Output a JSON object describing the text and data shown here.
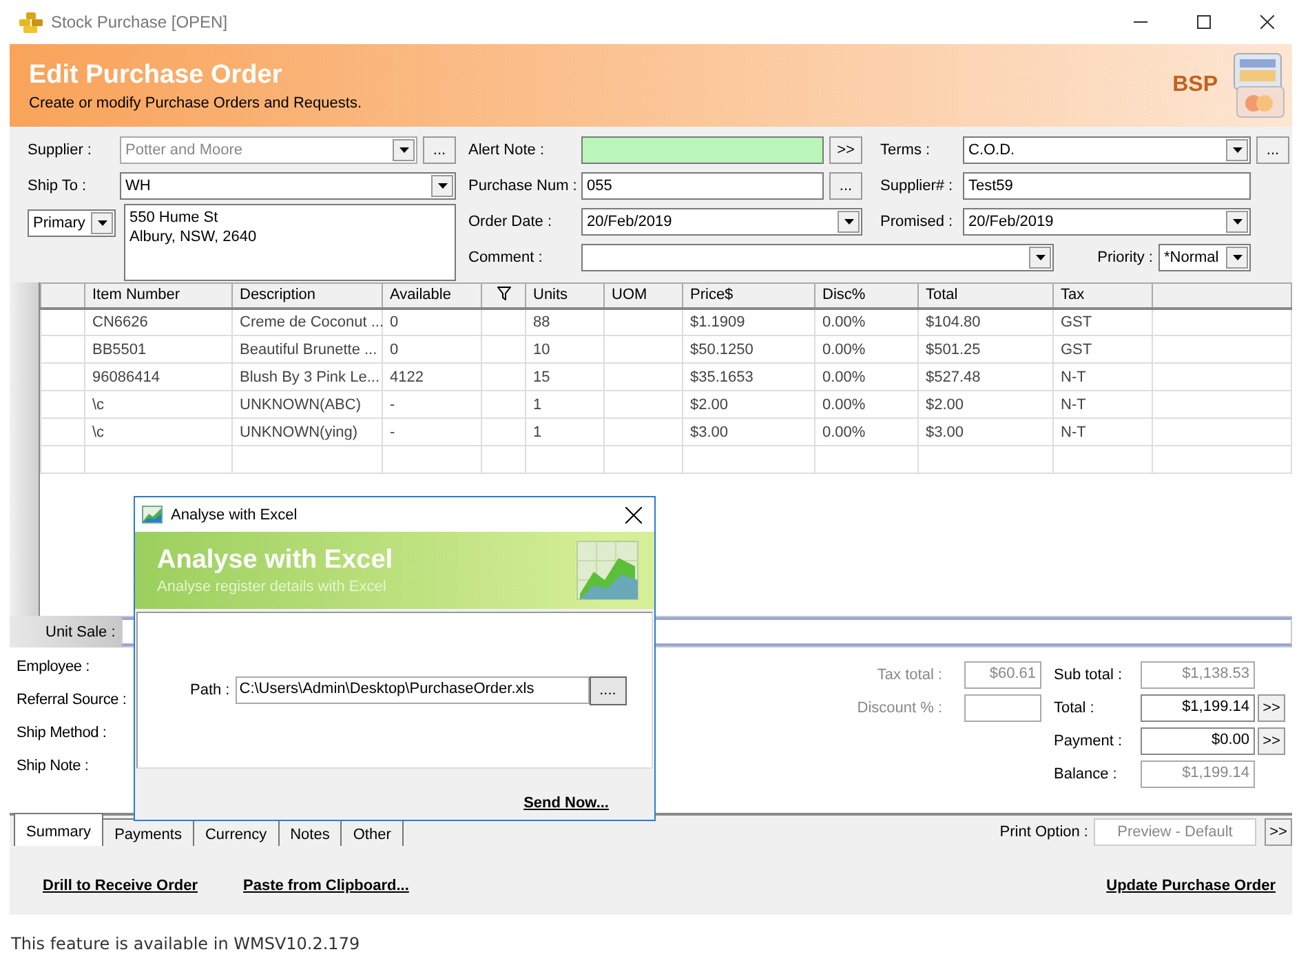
{
  "window": {
    "title": "Stock Purchase [OPEN]"
  },
  "header": {
    "title": "Edit Purchase Order",
    "subtitle": "Create or modify Purchase Orders and Requests.",
    "logo": "BSP"
  },
  "form": {
    "fields": [
      {
        "label": "Supplier :",
        "kind": "combo",
        "value": "Potter and Moore",
        "disabled": true,
        "button": "..."
      },
      {
        "label": "Alert Note :",
        "kind": "alert",
        "button": ">>"
      },
      {
        "label": "Terms :",
        "kind": "combo",
        "value": "C.O.D.",
        "button": "..."
      },
      {
        "label": "Ship To :",
        "kind": "combo",
        "value": "WH"
      },
      {
        "label": "Purchase Num :",
        "kind": "text",
        "value": "055",
        "button": "..."
      },
      {
        "label": "Supplier# :",
        "kind": "text",
        "value": "Test59"
      },
      {
        "kind": "address",
        "selector": "Primary",
        "value": "550 Hume St\nAlbury, NSW, 2640"
      },
      {
        "label": "Order Date :",
        "kind": "combo",
        "value": "20/Feb/2019"
      },
      {
        "label": "Promised :",
        "kind": "combo",
        "value": "20/Feb/2019"
      },
      {
        "label": "Comment :",
        "kind": "combo"
      },
      {
        "label": "Priority :",
        "kind": "combo",
        "value": "*Normal"
      }
    ]
  },
  "grid": {
    "columns": [
      {
        "label": "Item Number",
        "kind": "text"
      },
      {
        "label": "Description",
        "kind": "text"
      },
      {
        "label": "Available",
        "kind": "text"
      },
      {
        "kind": "filter"
      },
      {
        "label": "Units",
        "kind": "text"
      },
      {
        "label": "UOM",
        "kind": "text"
      },
      {
        "label": "Price$",
        "kind": "text"
      },
      {
        "label": "Disc%",
        "kind": "text"
      },
      {
        "label": "Total",
        "kind": "text"
      },
      {
        "label": "Tax",
        "kind": "text"
      }
    ],
    "rows": [
      [
        "CN6626",
        "Creme de Coconut ...",
        "0",
        "",
        "88",
        "",
        "$1.1909",
        "0.00%",
        "$104.80",
        "GST"
      ],
      [
        "BB5501",
        "Beautiful Brunette ...",
        "0",
        "",
        "10",
        "",
        "$50.1250",
        "0.00%",
        "$501.25",
        "GST"
      ],
      [
        "96086414",
        "Blush By 3 Pink Le...",
        "4122",
        "",
        "15",
        "",
        "$35.1653",
        "0.00%",
        "$527.48",
        "N-T"
      ],
      [
        "\\c",
        "UNKNOWN(ABC)",
        "-",
        "",
        "1",
        "",
        "$2.00",
        "0.00%",
        "$2.00",
        "N-T"
      ],
      [
        "\\c",
        "UNKNOWN(ying)",
        "-",
        "",
        "1",
        "",
        "$3.00",
        "0.00%",
        "$3.00",
        "N-T"
      ]
    ]
  },
  "unit_sale": {
    "label": "Unit Sale :"
  },
  "summary": {
    "labels": [
      "Employee :",
      "Referral Source :",
      "Ship Method :",
      "Ship Note :"
    ],
    "tax": [
      {
        "label": "Tax total :",
        "value": "$60.61",
        "disabled": true
      },
      {
        "label": "Discount % :",
        "disabled": true
      }
    ],
    "totals": [
      {
        "label": "Sub total :",
        "value": "$1,138.53",
        "disabled": true
      },
      {
        "label": "Total :",
        "value": "$1,199.14",
        "button": ">>"
      },
      {
        "label": "Payment :",
        "value": "$0.00",
        "button": ">>"
      },
      {
        "label": "Balance :",
        "value": "$1,199.14",
        "disabled": true
      }
    ]
  },
  "tabs": [
    {
      "label": "Summary",
      "selected": true
    },
    {
      "label": "Payments",
      "selected": false
    },
    {
      "label": "Currency",
      "selected": false
    },
    {
      "label": "Notes",
      "selected": false
    },
    {
      "label": "Other",
      "selected": false
    }
  ],
  "print_option": {
    "label": "Print Option :",
    "value": "Preview - Default",
    "button": ">>"
  },
  "actions": [
    "Drill to Receive Order",
    "Paste from Clipboard...",
    "Update Purchase Order"
  ],
  "dialog": {
    "title": "Analyse with Excel",
    "heading": "Analyse with Excel",
    "subtitle": "Analyse register details with Excel",
    "path_label": "Path :",
    "path": "C:\\Users\\Admin\\Desktop\\PurchaseOrder.xls",
    "browse": "....",
    "send": "Send Now..."
  },
  "footer": "This feature is available in WMSV10.2.179"
}
